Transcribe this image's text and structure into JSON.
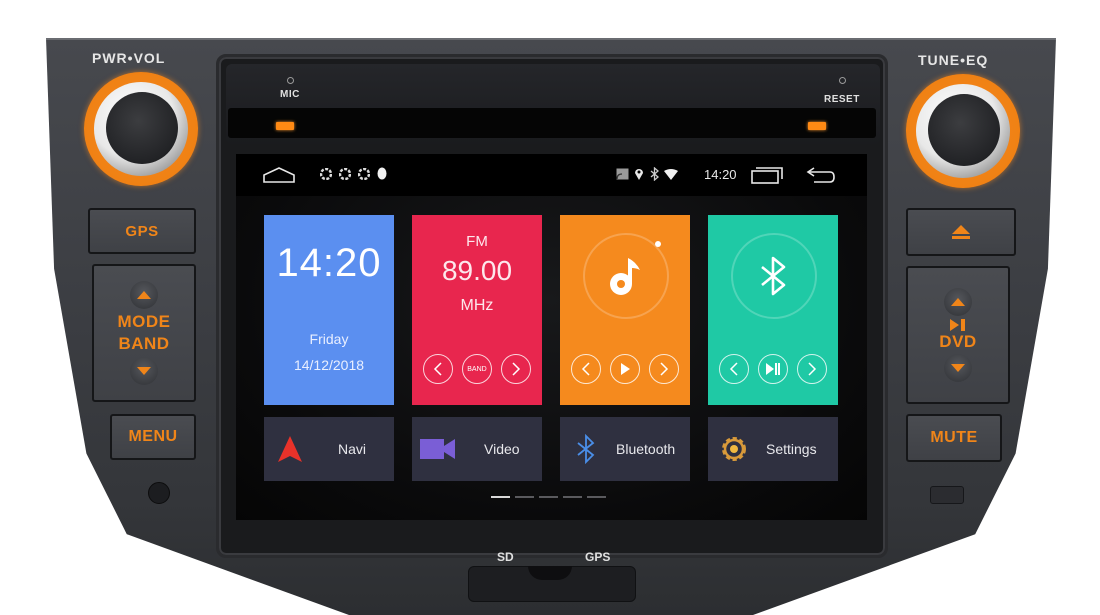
{
  "device": {
    "left_knob_label": "PWR•VOL",
    "right_knob_label": "TUNE•EQ",
    "mic_label": "MIC",
    "reset_label": "RESET",
    "sd_label": "SD",
    "gps_port_label": "GPS",
    "accent_color": "#f08519",
    "left_buttons": {
      "gps": "GPS",
      "mode": "MODE",
      "band": "BAND",
      "menu": "MENU"
    },
    "right_buttons": {
      "eject_icon": "eject-icon",
      "play_pause_icon": "play-pause-icon",
      "dvd": "DVD",
      "mute": "MUTE"
    }
  },
  "statusbar": {
    "time": "14:20",
    "left_icons": [
      "home-icon",
      "app-icon",
      "app-icon",
      "app-icon",
      "notification-dot-icon"
    ],
    "right_icons": [
      "cast-icon",
      "location-icon",
      "bluetooth-icon",
      "wifi-icon"
    ],
    "nav_icons": [
      "recent-apps-icon",
      "back-icon"
    ]
  },
  "tiles": {
    "clock": {
      "time": "14:20",
      "day": "Friday",
      "date": "14/12/2018",
      "color": "#5b8ff0"
    },
    "radio": {
      "band": "FM",
      "frequency": "89.00",
      "unit": "MHz",
      "band_button": "BAND",
      "color": "#e8264e"
    },
    "music": {
      "icon": "music-note-icon",
      "color": "#f58a1e"
    },
    "bluetooth": {
      "icon": "bluetooth-icon",
      "color": "#1fc9a5"
    }
  },
  "apps": [
    {
      "label": "Navi",
      "icon": "navigation-arrow-icon"
    },
    {
      "label": "Video",
      "icon": "video-camera-icon"
    },
    {
      "label": "Bluetooth",
      "icon": "bluetooth-icon"
    },
    {
      "label": "Settings",
      "icon": "gear-icon"
    }
  ],
  "pager": {
    "pages": 5,
    "current": 1
  }
}
